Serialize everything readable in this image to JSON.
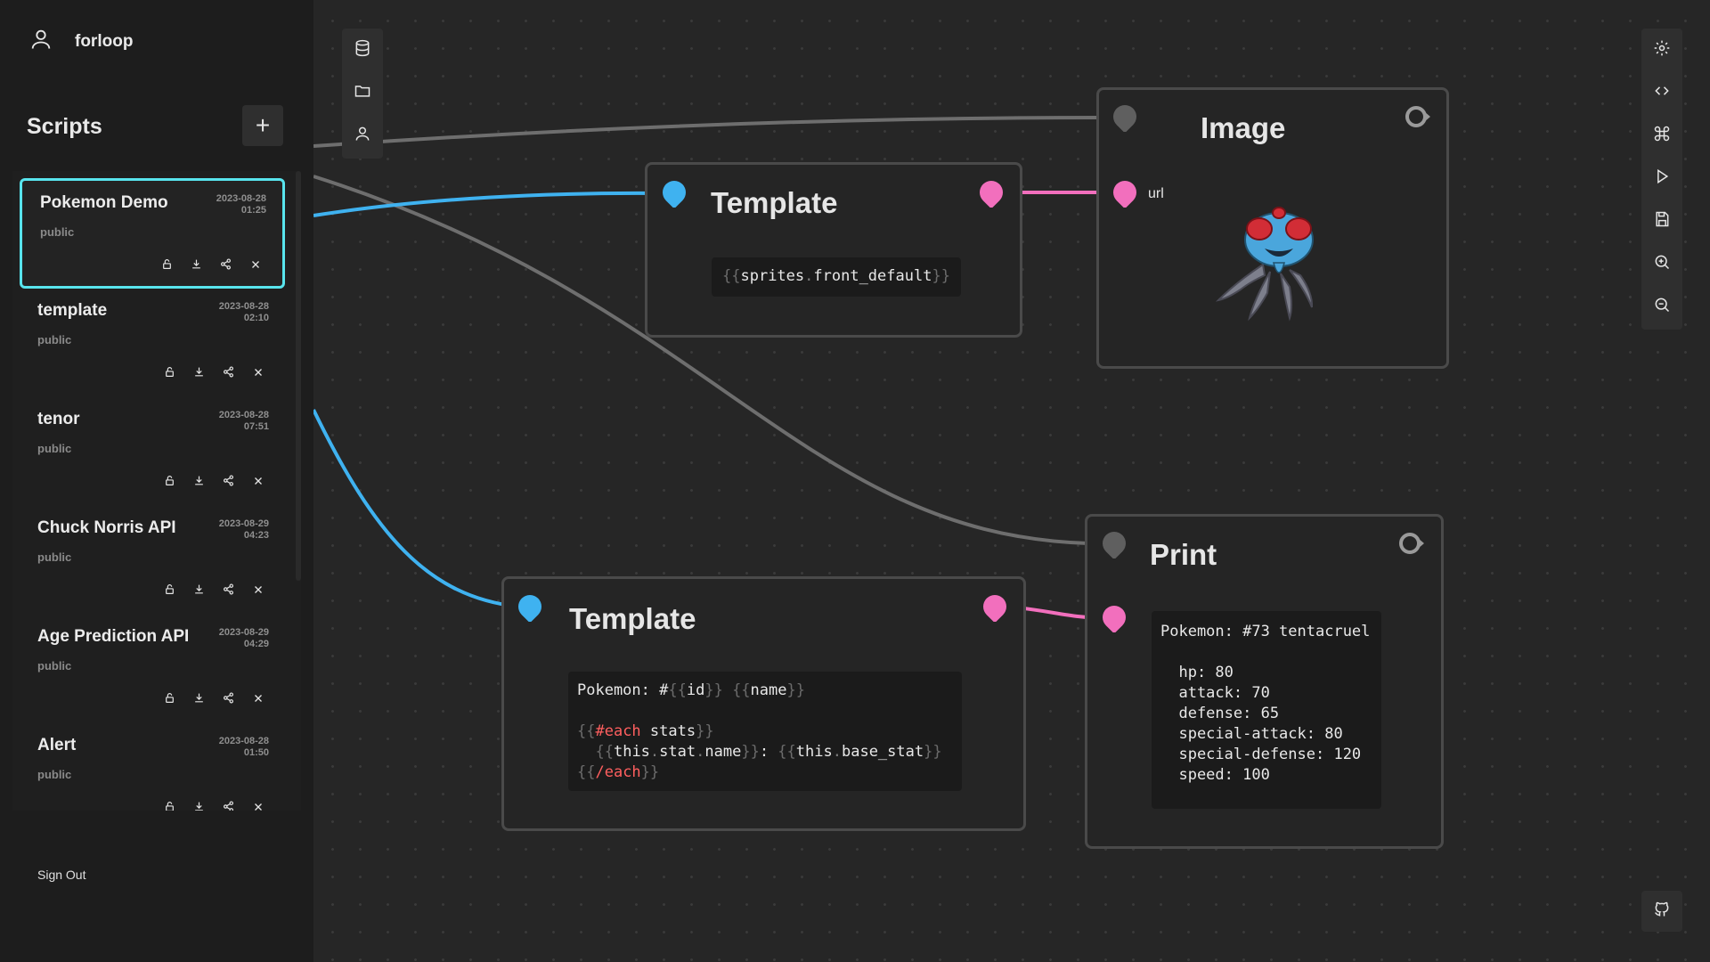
{
  "user": {
    "name": "forloop"
  },
  "sidebar": {
    "title": "Scripts",
    "add_label": "+",
    "sign_out": "Sign Out",
    "scripts": [
      {
        "name": "Pokemon Demo",
        "date": "2023-08-28",
        "time": "01:25",
        "visibility": "public",
        "active": true
      },
      {
        "name": "template",
        "date": "2023-08-28",
        "time": "02:10",
        "visibility": "public",
        "active": false
      },
      {
        "name": "tenor",
        "date": "2023-08-28",
        "time": "07:51",
        "visibility": "public",
        "active": false
      },
      {
        "name": "Chuck Norris API",
        "date": "2023-08-29",
        "time": "04:23",
        "visibility": "public",
        "active": false
      },
      {
        "name": "Age Prediction API",
        "date": "2023-08-29",
        "time": "04:29",
        "visibility": "public",
        "active": false
      },
      {
        "name": "Alert",
        "date": "2023-08-28",
        "time": "01:50",
        "visibility": "public",
        "active": false
      }
    ]
  },
  "toolbar_left": {
    "icons": [
      "database-icon",
      "folder-icon",
      "user-icon"
    ]
  },
  "toolbar_right": {
    "icons": [
      "settings-icon",
      "code-icon",
      "command-icon",
      "run-icon",
      "save-icon",
      "zoom-in-icon",
      "zoom-out-icon"
    ]
  },
  "nodes": {
    "template1": {
      "title": "Template",
      "code": "{{sprites.front_default}}"
    },
    "image": {
      "title": "Image",
      "port_label": "url"
    },
    "template2": {
      "title": "Template",
      "code_lines": [
        "Pokemon: #{{id}} {{name}}",
        "",
        "{{#each stats}}",
        "  {{this.stat.name}}: {{this.base_stat}}",
        "{{/each}}"
      ]
    },
    "print": {
      "title": "Print",
      "output": "Pokemon: #73 tentacruel\n\n  hp: 80\n  attack: 70\n  defense: 65\n  special-attack: 80\n  special-defense: 120\n  speed: 100"
    }
  },
  "colors": {
    "accent": "#58e4ed",
    "blue_port": "#3fb2f0",
    "pink_port": "#f26fbd",
    "gray_port": "#5f5f5f",
    "wire_gray": "#6e6e6e"
  }
}
